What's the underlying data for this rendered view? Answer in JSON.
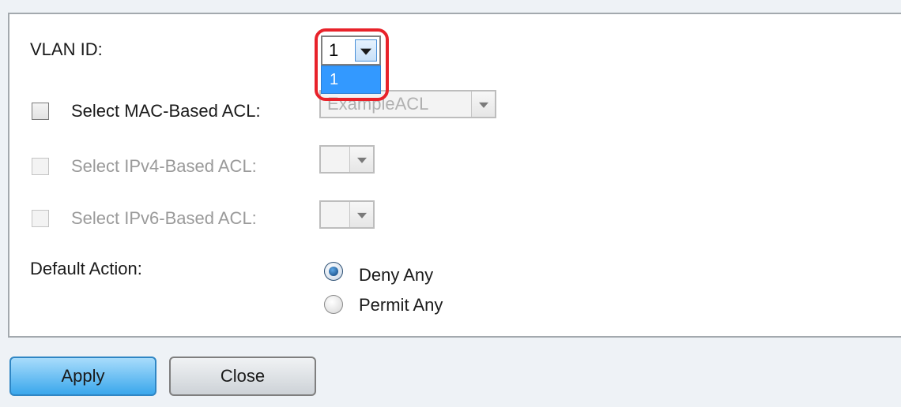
{
  "form": {
    "vlan_id": {
      "label": "VLAN ID:",
      "selected_value": "1",
      "options": [
        "1"
      ]
    },
    "mac_acl": {
      "label": "Select MAC-Based ACL:",
      "checked": false,
      "selected_value": "ExampleACL"
    },
    "ipv4_acl": {
      "label": "Select IPv4-Based ACL:",
      "checked": false,
      "selected_value": ""
    },
    "ipv6_acl": {
      "label": "Select IPv6-Based ACL:",
      "checked": false,
      "selected_value": ""
    },
    "default_action": {
      "label": "Default Action:",
      "options": [
        {
          "label": "Deny Any",
          "selected": true
        },
        {
          "label": "Permit Any",
          "selected": false
        }
      ]
    }
  },
  "buttons": {
    "apply_label": "Apply",
    "close_label": "Close"
  },
  "colors": {
    "highlight": "#e8222a",
    "dropdown_option_selected": "#3399ff",
    "apply_button": "#3aa7ec"
  }
}
